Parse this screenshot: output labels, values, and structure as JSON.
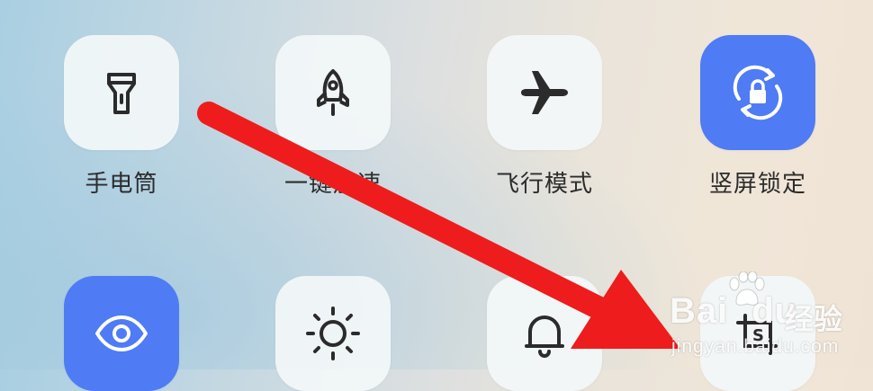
{
  "quick_settings": {
    "tiles": [
      {
        "id": "flashlight",
        "label": "手电筒",
        "icon": "flashlight-icon",
        "active": false
      },
      {
        "id": "speedup",
        "label": "一键加速",
        "icon": "rocket-icon",
        "active": false
      },
      {
        "id": "airplane",
        "label": "飞行模式",
        "icon": "airplane-icon",
        "active": false
      },
      {
        "id": "rotation-lock",
        "label": "竖屏锁定",
        "icon": "rotation-lock-icon",
        "active": true
      },
      {
        "id": "eye-comfort",
        "label": "",
        "icon": "eye-icon",
        "active": true
      },
      {
        "id": "dark-mode",
        "label": "",
        "icon": "brightness-icon",
        "active": false
      },
      {
        "id": "notification",
        "label": "",
        "icon": "bell-icon",
        "active": false
      },
      {
        "id": "screenshot",
        "label": "",
        "icon": "screenshot-icon",
        "active": false
      }
    ]
  },
  "overlay": {
    "arrow_color": "#ee1c1c"
  },
  "watermark": {
    "brand": "Bai",
    "brand_suffix": "du",
    "cn": "经验",
    "url": "jingyan.baidu.com"
  },
  "colors": {
    "active_tile": "#4f7bf4",
    "inactive_tile": "#f3f7f9",
    "icon_dark": "#2b2b2b"
  }
}
